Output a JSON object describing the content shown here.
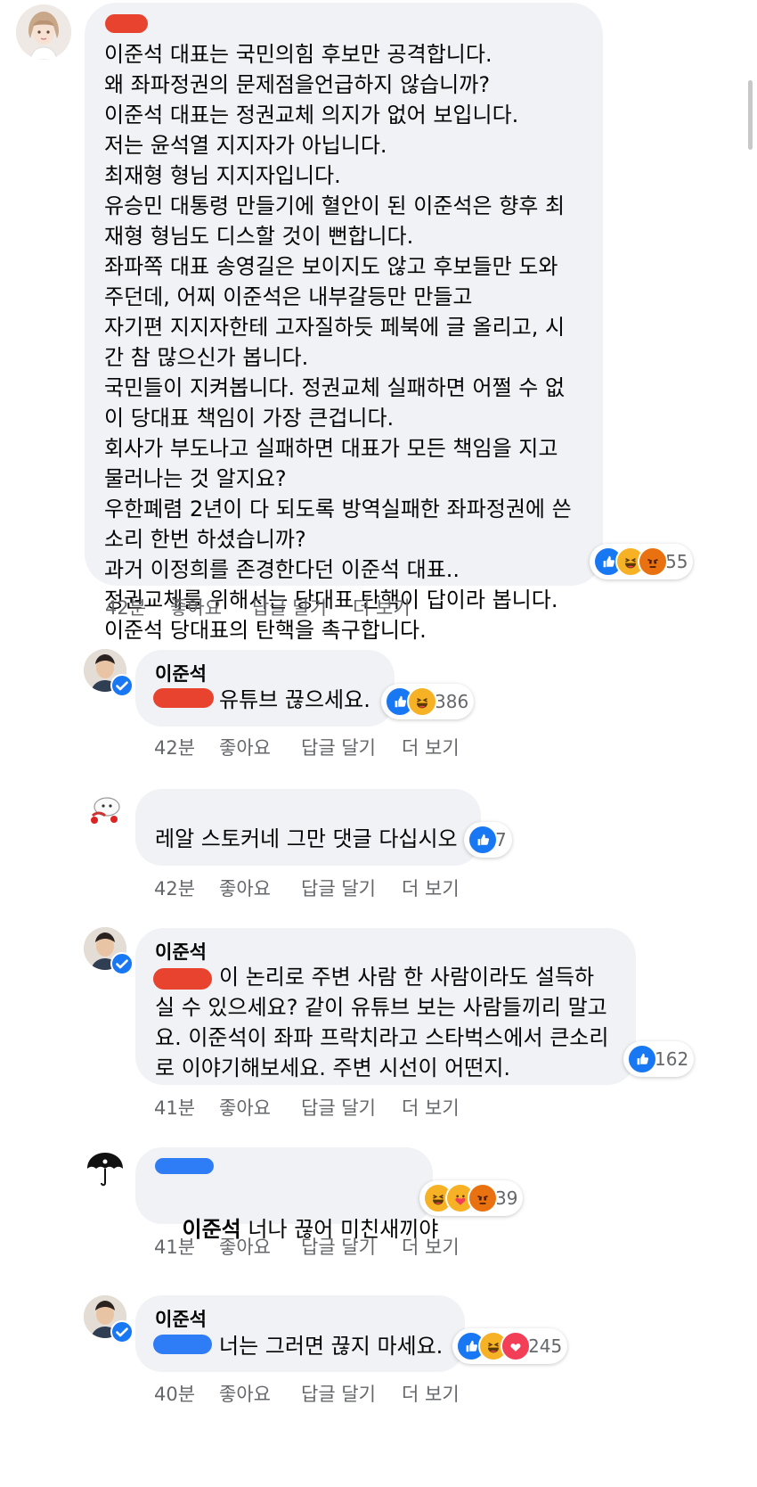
{
  "comments": [
    {
      "author": "",
      "text": "이준석 대표는 국민의힘 후보만 공격합니다.\n왜 좌파정권의 문제점을언급하지 않습니까?\n이준석 대표는 정권교체 의지가 없어 보입니다.\n저는 윤석열 지지자가 아닙니다.\n최재형 형님 지지자입니다.\n유승민 대통령 만들기에 혈안이 된 이준석은 향후 최\n재형 형님도 디스할 것이 뻔합니다.\n좌파쪽 대표 송영길은 보이지도 않고 후보들만 도와\n주던데, 어찌 이준석은 내부갈등만 만들고\n자기편 지지자한테 고자질하듯 페북에 글 올리고, 시\n간 참 많으신가 봅니다.\n국민들이 지켜봅니다. 정권교체 실패하면 어쩔 수 없\n이 당대표 책임이 가장 큰겁니다.\n회사가 부도나고 실패하면 대표가 모든 책임을 지고\n물러나는 것 알지요?\n우한폐렴 2년이 다 되도록 방역실패한 좌파정권에 쓴\n소리 한번 하셨습니까?\n과거 이정희를 존경한다던 이준석 대표..\n정권교체를 위해서는 당대표 탄핵이 답이라 봅니다.\n이준석 당대표의 탄핵을 촉구합니다.",
      "reactions": [
        "like-icon",
        "haha-icon",
        "angry-icon"
      ],
      "reaction_count": "55",
      "time": "42분",
      "like": "좋아요",
      "reply": "답글 달기",
      "more": "더 보기"
    },
    {
      "author": "이준석",
      "text": "유튜브 끊으세요.",
      "reactions": [
        "like-icon",
        "haha-icon"
      ],
      "reaction_count": "386",
      "time": "42분",
      "like": "좋아요",
      "reply": "답글 달기",
      "more": "더 보기"
    },
    {
      "author": "",
      "text": "레알 스토커네 그만 댓글 다십시오",
      "reactions": [
        "like-icon"
      ],
      "reaction_count": "7",
      "time": "42분",
      "like": "좋아요",
      "reply": "답글 달기",
      "more": "더 보기"
    },
    {
      "author": "이준석",
      "text": "이 논리로 주변 사람 한 사람이라도 설득하\n실 수 있으세요? 같이 유튜브 보는 사람들끼리 말고\n요. 이준석이 좌파 프락치라고 스타벅스에서 큰소리\n로 이야기해보세요. 주변 시선이 어떤지.",
      "reactions": [
        "like-icon"
      ],
      "reaction_count": "162",
      "time": "41분",
      "like": "좋아요",
      "reply": "답글 달기",
      "more": "더 보기"
    },
    {
      "author": "",
      "tag": "이준석",
      "text": "너나 끊어 미친새끼야",
      "reactions": [
        "haha-icon",
        "care-icon",
        "angry-icon"
      ],
      "reaction_count": "39",
      "time": "41분",
      "like": "좋아요",
      "reply": "답글 달기",
      "more": "더 보기"
    },
    {
      "author": "이준석",
      "text": "너는 그러면 끊지 마세요.",
      "reactions": [
        "like-icon",
        "haha-icon",
        "love-icon"
      ],
      "reaction_count": "245",
      "time": "40분",
      "like": "좋아요",
      "reply": "답글 달기",
      "more": "더 보기"
    }
  ],
  "colors": {
    "bubble": "#f0f2f5",
    "meta_text": "#65676b",
    "like": "#1877f2",
    "haha": "#f7b125",
    "angry": "#e9710f",
    "love": "#f33e58",
    "verified": "#1877f2",
    "redaction_red": "#e8432f",
    "redaction_blue": "#2f7df6"
  }
}
